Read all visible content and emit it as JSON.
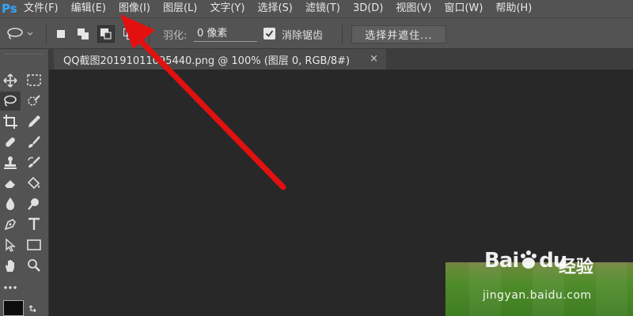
{
  "app": {
    "logo_text": "Ps"
  },
  "menu": [
    "文件(F)",
    "编辑(E)",
    "图像(I)",
    "图层(L)",
    "文字(Y)",
    "选择(S)",
    "滤镜(T)",
    "3D(D)",
    "视图(V)",
    "窗口(W)",
    "帮助(H)"
  ],
  "options": {
    "feather_label": "羽化:",
    "feather_value": "0 像素",
    "antialias_label": "消除锯齿",
    "antialias_checked": true,
    "select_mask_label": "选择并遮住..."
  },
  "document": {
    "tab_title": "QQ截图20191011095440.png @ 100% (图层 0, RGB/8#)",
    "close_glyph": "×"
  },
  "watermark": {
    "logo_bai": "Bai",
    "logo_du": "du",
    "jingyan": "经验",
    "url": "jingyan.baidu.com"
  },
  "colors": {
    "ui_panel": "#535353",
    "canvas_bg": "#282828",
    "arrow": "#e31010",
    "ps_blue": "#31a8ff"
  }
}
